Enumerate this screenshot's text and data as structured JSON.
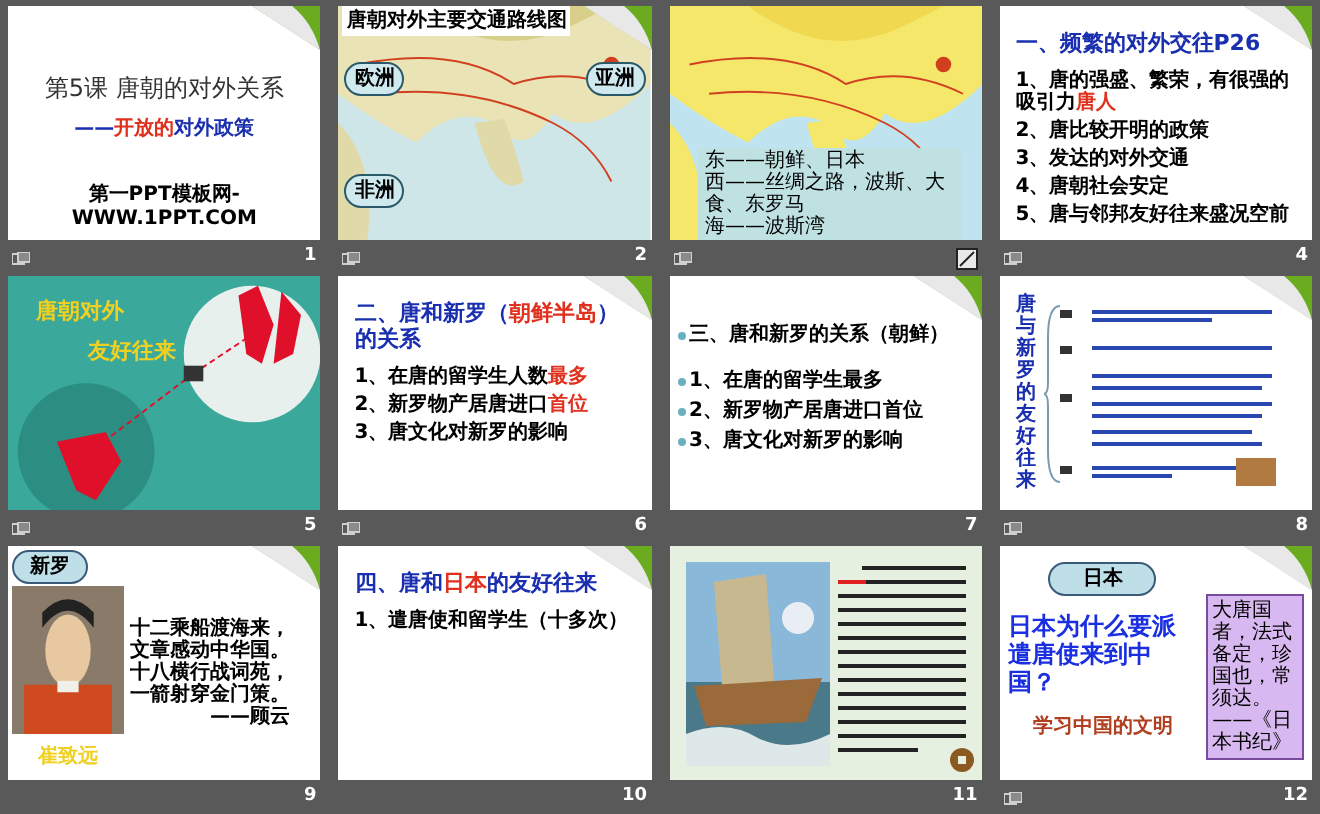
{
  "slides": [
    {
      "kind": "title",
      "number": "1",
      "transition": true,
      "curl": true,
      "title": "第5课  唐朝的对外关系",
      "subtitle": [
        {
          "text": "——",
          "color": "#1a2fb0"
        },
        {
          "text": "开放的",
          "color": "#e0301e"
        },
        {
          "text": "对外政策",
          "color": "#1a2fb0"
        }
      ],
      "footer": "第一PPT模板网-WWW.1PPT.COM"
    },
    {
      "kind": "map",
      "number": "2",
      "transition": true,
      "curl": true,
      "title": "唐朝对外主要交通路线图",
      "labels": [
        "欧洲",
        "亚洲",
        "非洲"
      ]
    },
    {
      "kind": "map_box",
      "transition": true,
      "curl": false,
      "note_icon": true,
      "lines": [
        "东——朝鲜、日本",
        "西——丝绸之路，波斯、大食、东罗马",
        "海——波斯湾"
      ]
    },
    {
      "kind": "list",
      "number": "4",
      "transition": true,
      "curl": true,
      "heading": [
        {
          "text": "一、频繁的对外交往",
          "color": "#1a2fb0"
        },
        {
          "text": "P26",
          "color": "#1a2fb0"
        }
      ],
      "items": [
        [
          {
            "text": "1、唐的强盛、繁荣，有很强的吸引力",
            "color": "#000000"
          },
          {
            "text": "唐人",
            "color": "#e0301e"
          }
        ],
        [
          {
            "text": "2、唐比较开明的政策",
            "color": "#000000"
          }
        ],
        [
          {
            "text": "3、发达的对外交通",
            "color": "#000000"
          }
        ],
        [
          {
            "text": "4、唐朝社会安定",
            "color": "#000000"
          }
        ],
        [
          {
            "text": "5、唐与邻邦友好往来盛况空前",
            "color": "#000000"
          }
        ]
      ]
    },
    {
      "kind": "poster",
      "number": "5",
      "transition": true,
      "curl": false,
      "title_lines": [
        "唐朝对外",
        "友好往来"
      ]
    },
    {
      "kind": "list",
      "number": "6",
      "transition": true,
      "curl": true,
      "heading": [
        {
          "text": "二、唐和新罗（",
          "color": "#1a2fb0"
        },
        {
          "text": "朝鲜半岛",
          "color": "#e0301e"
        },
        {
          "text": "）的关系",
          "color": "#1a2fb0"
        }
      ],
      "items": [
        [
          {
            "text": "1、在唐的留学生人数",
            "color": "#000000"
          },
          {
            "text": "最多",
            "color": "#e0301e"
          }
        ],
        [
          {
            "text": "2、新罗物产居唐进口",
            "color": "#000000"
          },
          {
            "text": "首位",
            "color": "#e0301e"
          }
        ],
        [
          {
            "text": "3、唐文化对新罗的影响",
            "color": "#000000"
          }
        ]
      ]
    },
    {
      "kind": "bullets",
      "number": "7",
      "transition": false,
      "curl": true,
      "items": [
        "三、唐和新罗的关系（朝鲜）",
        "1、在唐的留学生最多",
        "2、新罗物产居唐进口首位",
        "3、唐文化对新罗的影响"
      ]
    },
    {
      "kind": "diagram",
      "number": "8",
      "transition": true,
      "curl": true,
      "title": "唐与新罗的友好往来"
    },
    {
      "kind": "portrait",
      "number": "9",
      "transition": false,
      "curl": true,
      "tag": "新罗",
      "poem": [
        "十二乘船渡海来，",
        "文章感动中华国。",
        "十八横行战词苑，",
        "一箭射穿金门策。"
      ],
      "author": "——顾云",
      "caption": "崔致远"
    },
    {
      "kind": "list",
      "number": "10",
      "transition": false,
      "curl": true,
      "heading": [
        {
          "text": "四、唐和",
          "color": "#1a2fb0"
        },
        {
          "text": "日本",
          "color": "#e0301e"
        },
        {
          "text": "的友好往来",
          "color": "#1a2fb0"
        }
      ],
      "items": [
        [
          {
            "text": "1、遣唐使和留学生（十多次）",
            "color": "#000000"
          }
        ]
      ]
    },
    {
      "kind": "ship",
      "number": "11",
      "transition": false,
      "curl": false
    },
    {
      "kind": "question",
      "number": "12",
      "transition": true,
      "curl": true,
      "tag": "日本",
      "question": "日本为什么要派遣唐使来到中国？",
      "answer": "学习中国的文明",
      "quote": "大唐国者，法式备定，珍国也，常须达。",
      "source": "——《日本书纪》"
    }
  ]
}
